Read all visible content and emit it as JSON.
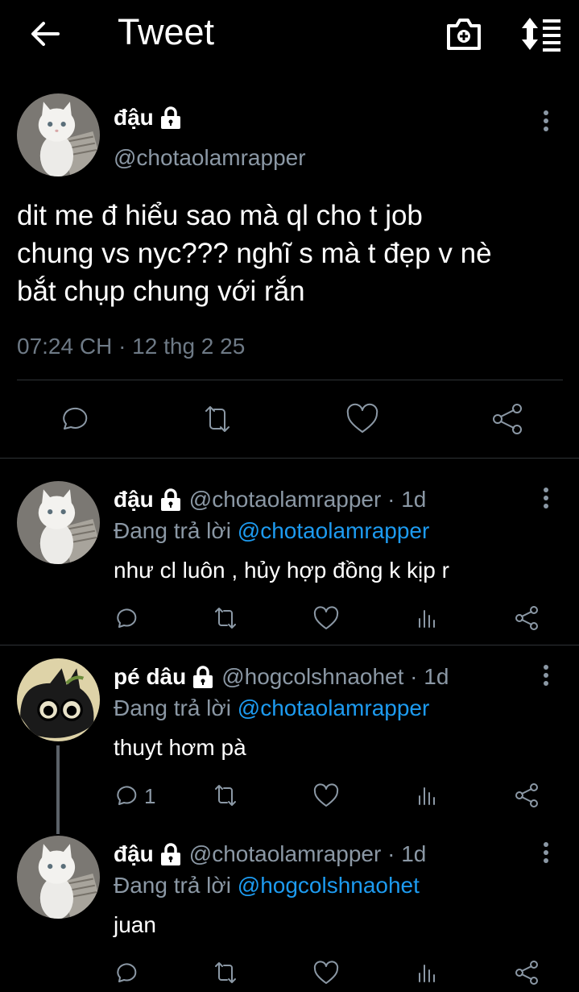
{
  "header": {
    "title": "Tweet",
    "back_icon": "back-arrow-icon",
    "camera_icon": "camera-plus-icon",
    "sort_icon": "sort-icon"
  },
  "main": {
    "name": "đậu",
    "handle": "@chotaolamrapper",
    "text_lines": [
      "dit me đ hiểu sao mà ql cho t job",
      "chung vs nyc??? nghĩ s mà t đẹp v nè",
      "bắt chụp chung với rắn"
    ],
    "timestamp": "07:24 CH · 12 thg 2 25"
  },
  "replies": [
    {
      "name": "đậu",
      "handle": "@chotaolamrapper · 1d",
      "replying_prefix": "Đang trả lời ",
      "replying_to": "@chotaolamrapper",
      "text": "như cl luôn , hủy hợp đồng k kịp r",
      "reply_count": ""
    },
    {
      "name": "pé dâu",
      "handle": "@hogcolshnaohet · 1d",
      "replying_prefix": "Đang trả lời ",
      "replying_to": "@chotaolamrapper",
      "text": "thuyt hơm pà",
      "reply_count": "1"
    },
    {
      "name": "đậu",
      "handle": "@chotaolamrapper · 1d",
      "replying_prefix": "Đang trả lời ",
      "replying_to": "@hogcolshnaohet",
      "text": "juan",
      "reply_count": ""
    }
  ],
  "colors": {
    "background": "#000000",
    "text": "#ffffff",
    "secondary": "#8b98a5",
    "link": "#1d9bf0",
    "divider": "#2f3336"
  }
}
